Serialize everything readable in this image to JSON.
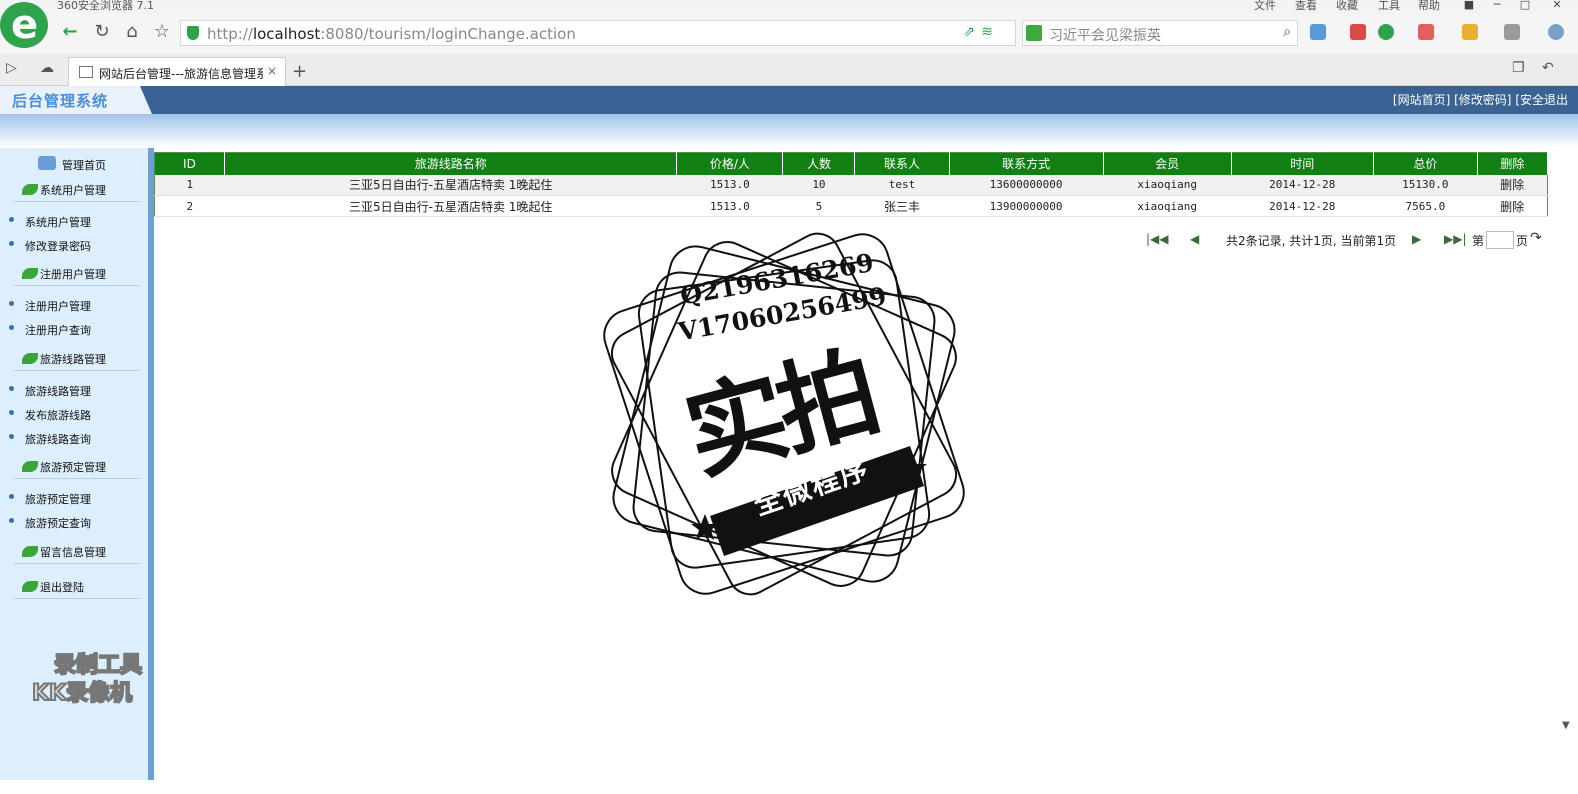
{
  "browser": {
    "title": "360安全浏览器 7.1",
    "menu": [
      "文件",
      "查看",
      "收藏",
      "工具",
      "帮助"
    ],
    "url_prefix": "http://",
    "url_host": "localhost",
    "url_rest": ":8080/tourism/loginChange.action",
    "search_placeholder": "习近平会见梁振英",
    "tab_title": "网站后台管理---旅游信息管理系",
    "tab_close": "×",
    "new_tab": "+",
    "accent": "#2ea34b"
  },
  "header": {
    "logo": "后台管理系统",
    "links": [
      "[网站首页]",
      "[修改密码]",
      "[安全退出"
    ],
    "bg_color": "#3a6292"
  },
  "sidebar": {
    "home": "管理首页",
    "groups": [
      {
        "title": "系统用户管理",
        "items": [
          "系统用户管理",
          "修改登录密码"
        ]
      },
      {
        "title": "注册用户管理",
        "items": [
          "注册用户管理",
          "注册用户查询"
        ]
      },
      {
        "title": "旅游线路管理",
        "items": [
          "旅游线路管理",
          "发布旅游线路",
          "旅游线路查询"
        ]
      },
      {
        "title": "旅游预定管理",
        "items": [
          "旅游预定管理",
          "旅游预定查询"
        ]
      },
      {
        "title": "留言信息管理",
        "items": []
      },
      {
        "title": "退出登陆",
        "items": []
      }
    ]
  },
  "table": {
    "header_color": "#128012",
    "columns": [
      "ID",
      "旅游线路名称",
      "价格/人",
      "人数",
      "联系人",
      "联系方式",
      "会员",
      "时间",
      "总价",
      "删除"
    ],
    "rows": [
      [
        "1",
        "三亚5日自由行-五星酒店特卖 1晚起住",
        "1513.0",
        "10",
        "test",
        "13600000000",
        "xiaoqiang",
        "2014-12-28",
        "15130.0",
        "删除"
      ],
      [
        "2",
        "三亚5日自由行-五星酒店特卖 1晚起住",
        "1513.0",
        "5",
        "张三丰",
        "13900000000",
        "xiaoqiang",
        "2014-12-28",
        "7565.0",
        "删除"
      ]
    ]
  },
  "pager": {
    "summary": "共2条记录, 共计1页, 当前第1页",
    "page_label_pre": "第",
    "page_label_post": "页",
    "page_value": ""
  },
  "watermark": {
    "qq": "Q2196316269",
    "wx": "V17060256499",
    "main": "实拍",
    "banner": "全微程序",
    "recorder_line1": "录制工具",
    "recorder_line2": "KK录像机"
  }
}
